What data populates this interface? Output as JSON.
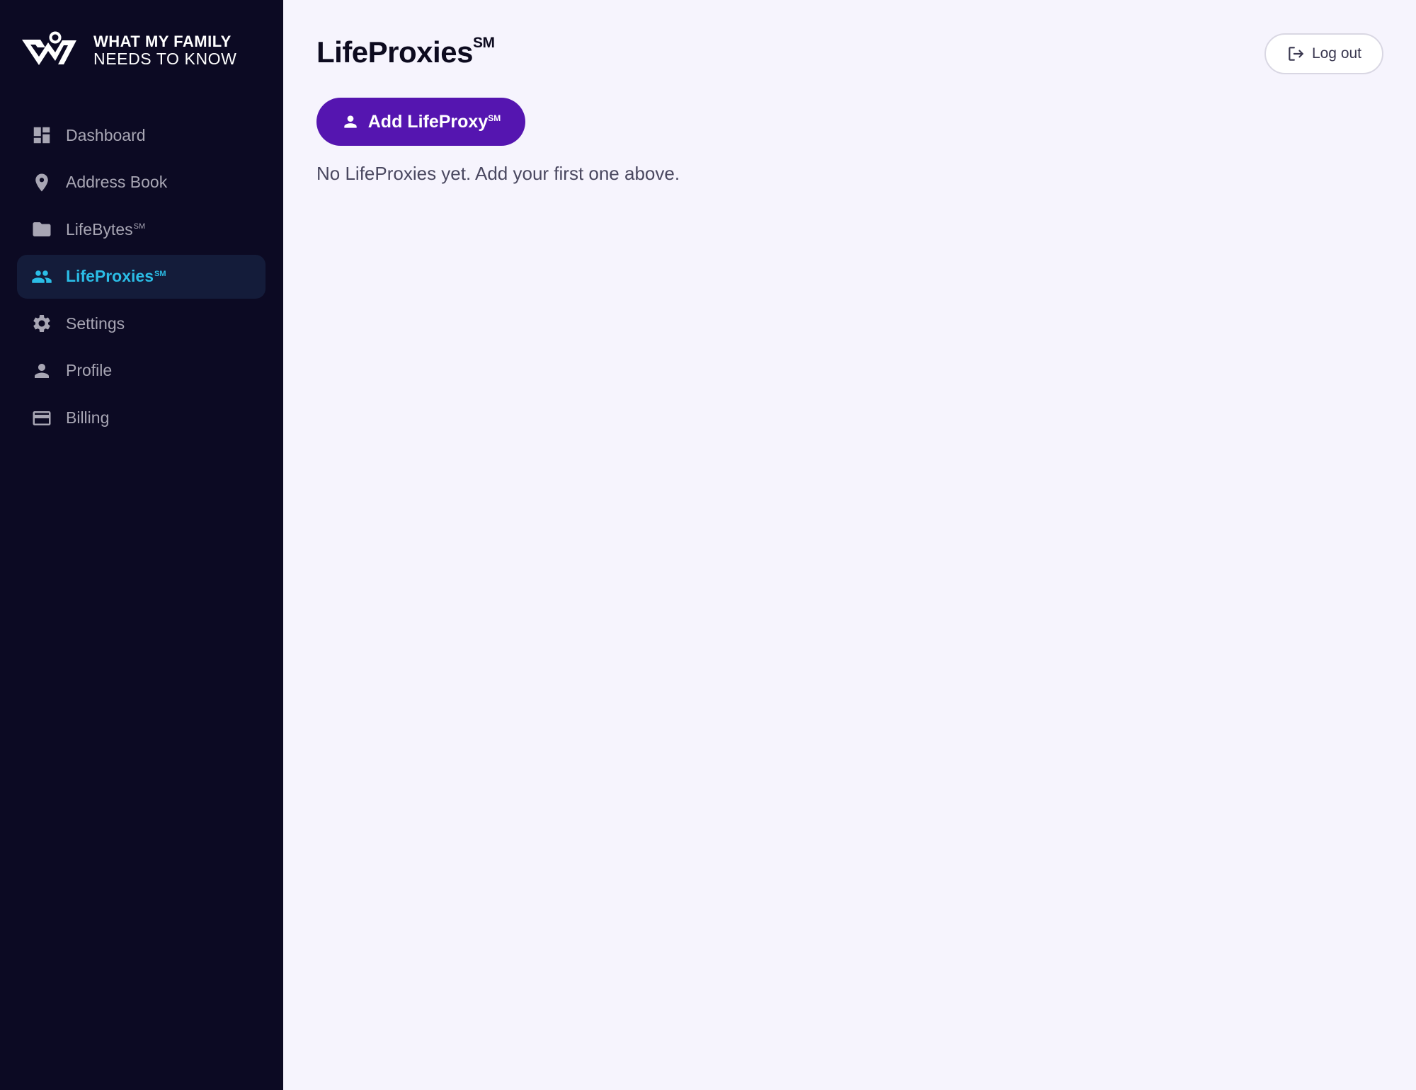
{
  "brand": {
    "line1": "WHAT MY FAMILY",
    "line2": "NEEDS TO KNOW",
    "logo_icon": "wmfntk-logo-icon"
  },
  "sidebar": {
    "items": [
      {
        "label": "Dashboard",
        "sup": "",
        "icon": "dashboard-icon",
        "active": false
      },
      {
        "label": "Address Book",
        "sup": "",
        "icon": "location-pin-icon",
        "active": false
      },
      {
        "label": "LifeBytes",
        "sup": "SM",
        "icon": "folder-icon",
        "active": false
      },
      {
        "label": "LifeProxies",
        "sup": "SM",
        "icon": "people-icon",
        "active": true
      },
      {
        "label": "Settings",
        "sup": "",
        "icon": "gear-icon",
        "active": false
      },
      {
        "label": "Profile",
        "sup": "",
        "icon": "person-icon",
        "active": false
      },
      {
        "label": "Billing",
        "sup": "",
        "icon": "credit-card-icon",
        "active": false
      }
    ]
  },
  "header": {
    "title": "LifeProxies",
    "title_sup": "SM",
    "logout_label": "Log out"
  },
  "main": {
    "add_button_label": "Add LifeProxy",
    "add_button_sup": "SM",
    "empty_message": "No LifeProxies yet. Add your first one above."
  },
  "colors": {
    "sidebar_bg": "#0c0a23",
    "main_bg": "#f6f4fd",
    "accent": "#5515b0",
    "active_nav": "#2bbde6",
    "active_nav_bg": "#141c3a"
  }
}
